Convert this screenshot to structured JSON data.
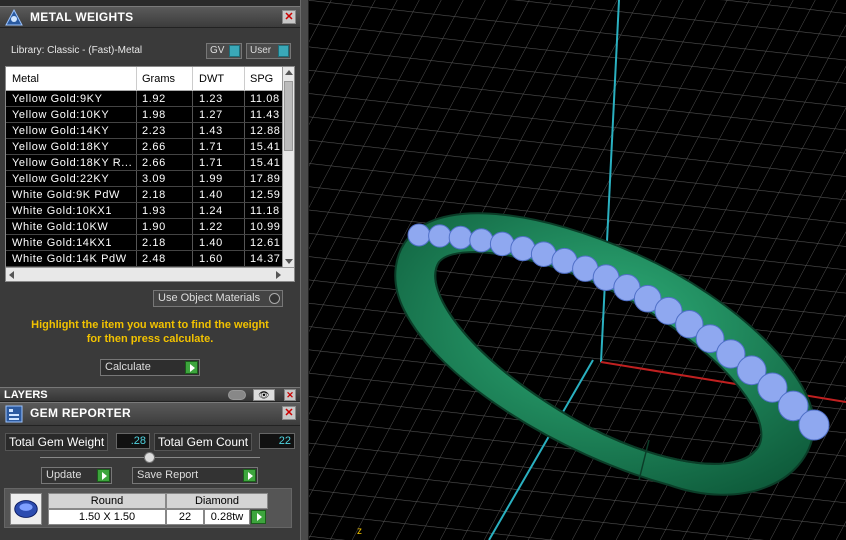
{
  "metal_weights_panel": {
    "title": "METAL WEIGHTS",
    "library_label": "Library: Classic - (Fast)-Metal",
    "gv_toggle": "GV",
    "user_toggle": "User",
    "columns": [
      "Metal",
      "Grams",
      "DWT",
      "SPG"
    ],
    "rows": [
      [
        "Yellow Gold:9KY",
        "1.92",
        "1.23",
        "11.08"
      ],
      [
        "Yellow Gold:10KY",
        "1.98",
        "1.27",
        "11.43"
      ],
      [
        "Yellow Gold:14KY",
        "2.23",
        "1.43",
        "12.88"
      ],
      [
        "Yellow Gold:18KY",
        "2.66",
        "1.71",
        "15.41"
      ],
      [
        "Yellow Gold:18KY R...",
        "2.66",
        "1.71",
        "15.41"
      ],
      [
        "Yellow Gold:22KY",
        "3.09",
        "1.99",
        "17.89"
      ],
      [
        "White Gold:9K PdW",
        "2.18",
        "1.40",
        "12.59"
      ],
      [
        "White Gold:10KX1",
        "1.93",
        "1.24",
        "11.18"
      ],
      [
        "White Gold:10KW",
        "1.90",
        "1.22",
        "10.99"
      ],
      [
        "White Gold:14KX1",
        "2.18",
        "1.40",
        "12.61"
      ],
      [
        "White Gold:14K PdW",
        "2.48",
        "1.60",
        "14.37"
      ]
    ],
    "use_object_materials": "Use Object Materials",
    "hint_line1": "Highlight the item you want to find the weight",
    "hint_line2": "for then press calculate.",
    "calculate_button": "Calculate"
  },
  "layers_panel": {
    "title": "LAYERS"
  },
  "gem_reporter_panel": {
    "title": "GEM REPORTER",
    "total_gem_weight_label": "Total Gem Weight",
    "total_gem_weight_value": ".28",
    "total_gem_count_label": "Total Gem Count",
    "total_gem_count_value": "22",
    "update_button": "Update",
    "save_report_button": "Save Report",
    "gem_row": {
      "shape": "Round",
      "size": "1.50 X 1.50",
      "type": "Diamond",
      "count": "22",
      "weight": "0.28tw"
    }
  },
  "viewport": {
    "axis_label": "z"
  },
  "colors": {
    "ring": "#1a8a5a",
    "gems": "#8fa8f0",
    "hint": "#f2c200",
    "grid": "#5a5a5a",
    "axis_cyan": "#2ab0c0",
    "axis_red": "#c02020"
  }
}
